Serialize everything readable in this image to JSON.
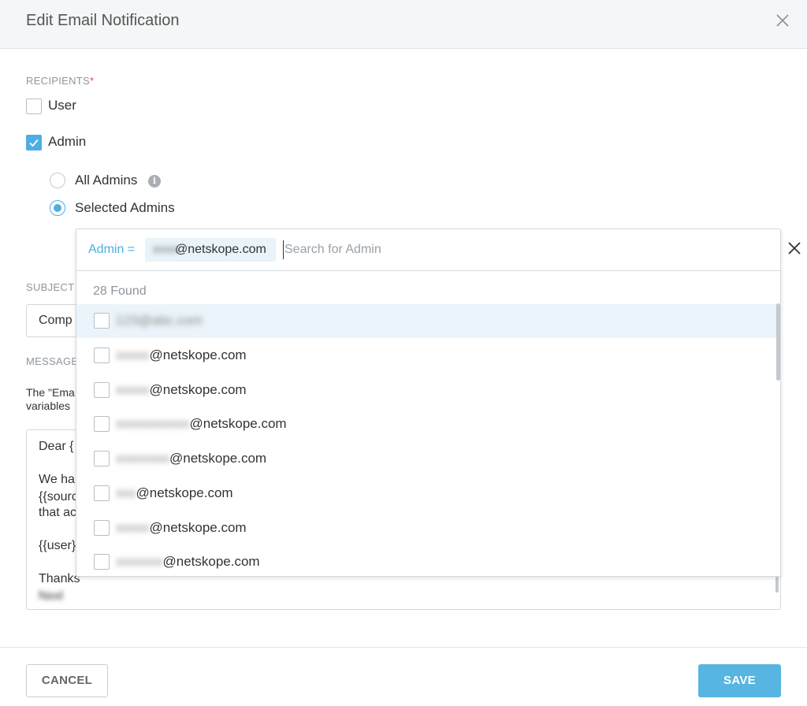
{
  "dialog": {
    "title": "Edit Email Notification"
  },
  "recipients": {
    "label": "RECIPIENTS",
    "required_mark": "*",
    "user_label": "User",
    "user_checked": false,
    "admin_label": "Admin",
    "admin_checked": true,
    "all_admins_label": "All Admins",
    "selected_admins_label": "Selected Admins",
    "selected_option": "Selected Admins"
  },
  "subject": {
    "label": "SUBJECT",
    "value": "Comp"
  },
  "message": {
    "label": "MESSAGE",
    "helper_line1": "The \"Ema",
    "helper_line2": "variables",
    "lines": [
      "Dear {",
      "We ha",
      "{{sourc",
      "that ac",
      "{{user}",
      "Thanks"
    ]
  },
  "admin_picker": {
    "filter_key": "Admin =",
    "chip_domain": "@netskope.com",
    "search_placeholder": "Search for Admin",
    "found_text": "28 Found",
    "items": [
      {
        "domain": "",
        "checked": false
      },
      {
        "domain": "@netskope.com",
        "checked": false
      },
      {
        "domain": "@netskope.com",
        "checked": false
      },
      {
        "domain": "@netskope.com",
        "checked": false
      },
      {
        "domain": "@netskope.com",
        "checked": false
      },
      {
        "domain": "@netskope.com",
        "checked": false
      },
      {
        "domain": "@netskope.com",
        "checked": false
      },
      {
        "domain": "@netskope.com",
        "checked": false
      }
    ]
  },
  "footer": {
    "cancel_label": "CANCEL",
    "save_label": "SAVE"
  },
  "colors": {
    "accent": "#4eaee3",
    "save_button": "#57b5e2",
    "required": "#e0465a",
    "highlight_row": "#eaf4fa"
  },
  "icons": [
    "close-icon",
    "check-icon",
    "info-icon"
  ]
}
